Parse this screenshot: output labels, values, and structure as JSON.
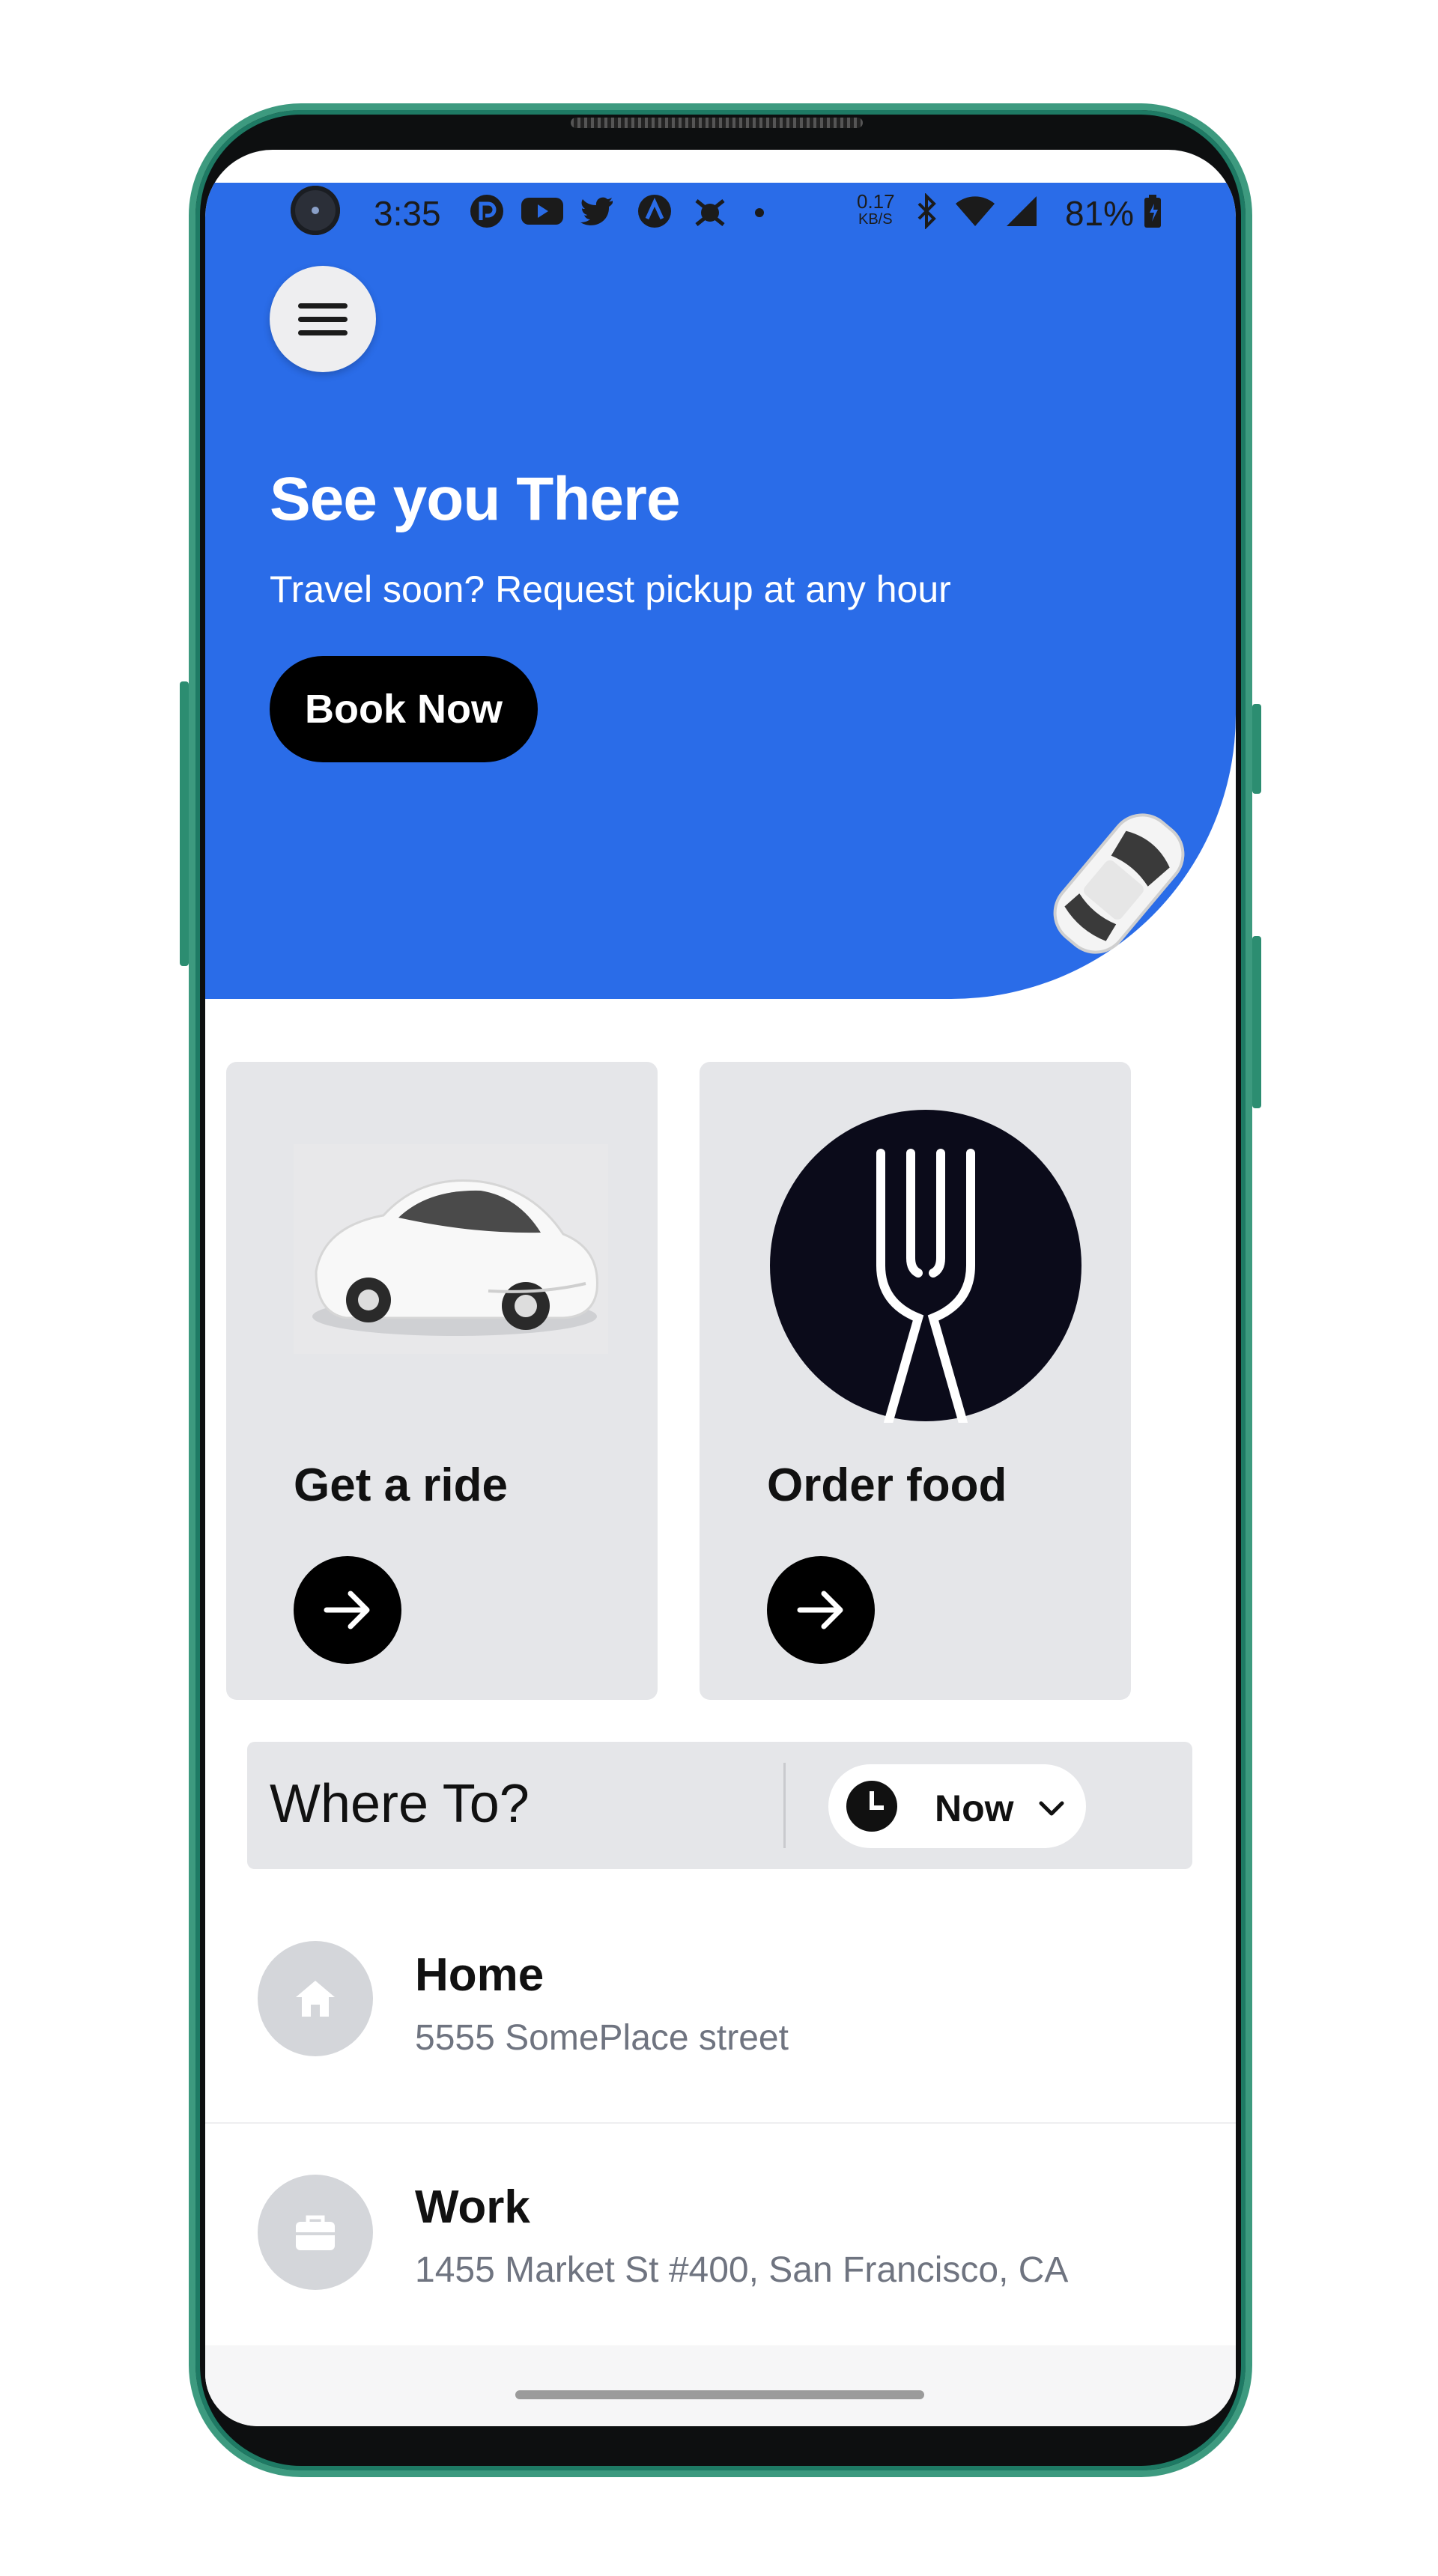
{
  "status_bar": {
    "time": "3:35",
    "network_speed": "0.17",
    "network_unit": "KB/S",
    "battery": "81%",
    "icons": [
      "camera-icon",
      "pocket-casts-icon",
      "youtube-icon",
      "twitter-icon",
      "arch-icon",
      "bug-icon",
      "dot-icon",
      "bluetooth-icon",
      "wifi-icon",
      "signal-icon",
      "battery-icon"
    ]
  },
  "hero": {
    "title": "See you There",
    "subtitle": "Travel soon? Request pickup at any hour",
    "cta": "Book Now",
    "background_color": "#2a6ce8"
  },
  "tiles": [
    {
      "title": "Get a ride",
      "icon": "car-icon"
    },
    {
      "title": "Order food",
      "icon": "fork-icon"
    }
  ],
  "search": {
    "placeholder": "Where To?",
    "when": "Now"
  },
  "saved_places": [
    {
      "name": "Home",
      "address": "5555 SomePlace street",
      "icon": "home-icon"
    },
    {
      "name": "Work",
      "address": "1455 Market St #400, San Francisco, CA",
      "icon": "briefcase-icon"
    }
  ]
}
